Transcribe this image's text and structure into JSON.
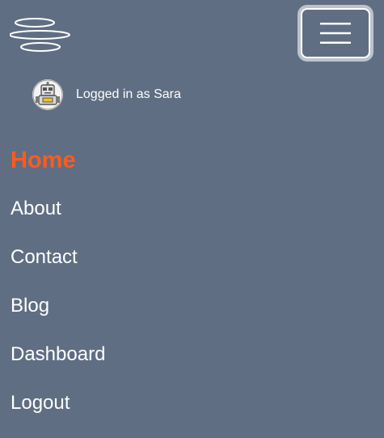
{
  "header": {
    "logo_icon": "stacked-rings-logo",
    "menu_icon": "hamburger-menu-icon"
  },
  "user": {
    "avatar_icon": "robot-avatar",
    "status_text": "Logged in as Sara"
  },
  "nav": {
    "items": [
      {
        "label": "Home",
        "active": true
      },
      {
        "label": "About",
        "active": false
      },
      {
        "label": "Contact",
        "active": false
      },
      {
        "label": "Blog",
        "active": false
      },
      {
        "label": "Dashboard",
        "active": false
      },
      {
        "label": "Logout",
        "active": false
      }
    ]
  },
  "colors": {
    "background": "#5f6e82",
    "active_link": "#ff5a1f",
    "text": "#ffffff",
    "toggle_outline": "#bcc3cd"
  }
}
